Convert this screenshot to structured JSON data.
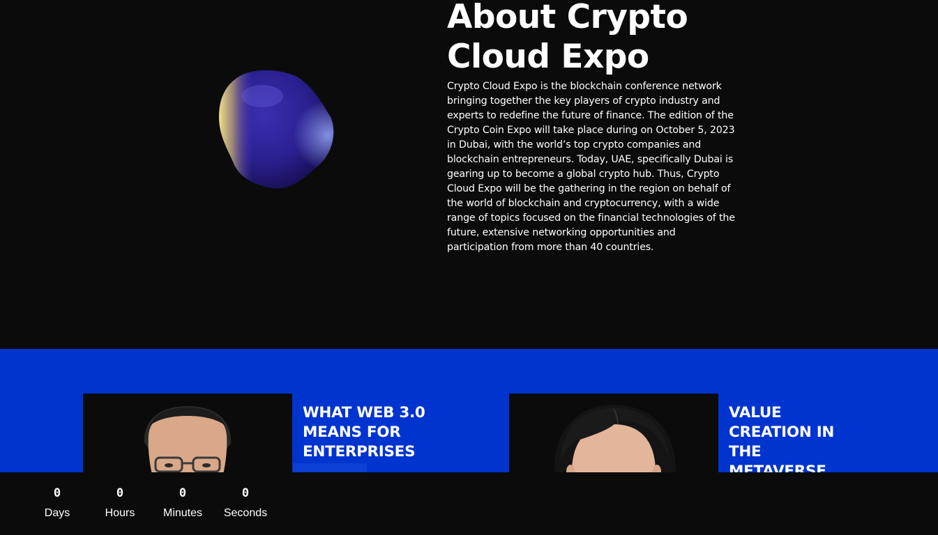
{
  "about": {
    "title": "About Crypto Cloud Expo",
    "paragraph": "Crypto Cloud Expo is the blockchain conference network bringing together the key players of crypto industry and experts to redefine the future of finance. The edition of the Crypto Coin Expo will take place during on October 5, 2023 in Dubai, with the world’s top crypto companies and blockchain entrepreneurs. Today, UAE, specifically Dubai is gearing up to become a global crypto hub. Thus, Crypto Cloud Expo will be the gathering in the region on behalf of the world of blockchain and cryptocurrency, with a wide range of topics focused on the financial technologies of the future, extensive networking opportunities and participation from more than 40 countries."
  },
  "sessions": [
    {
      "title": "WHAT WEB 3.0 MEANS FOR ENTERPRISES"
    },
    {
      "title": "VALUE CREATION IN THE METAVERSE"
    }
  ],
  "countdown": {
    "days": {
      "value": "0",
      "label": "Days"
    },
    "hours": {
      "value": "0",
      "label": "Hours"
    },
    "minutes": {
      "value": "0",
      "label": "Minutes"
    },
    "seconds": {
      "value": "0",
      "label": "Seconds"
    }
  },
  "colors": {
    "background": "#0b0b0b",
    "accent_blue": "#0034cf",
    "text": "#ffffff"
  }
}
